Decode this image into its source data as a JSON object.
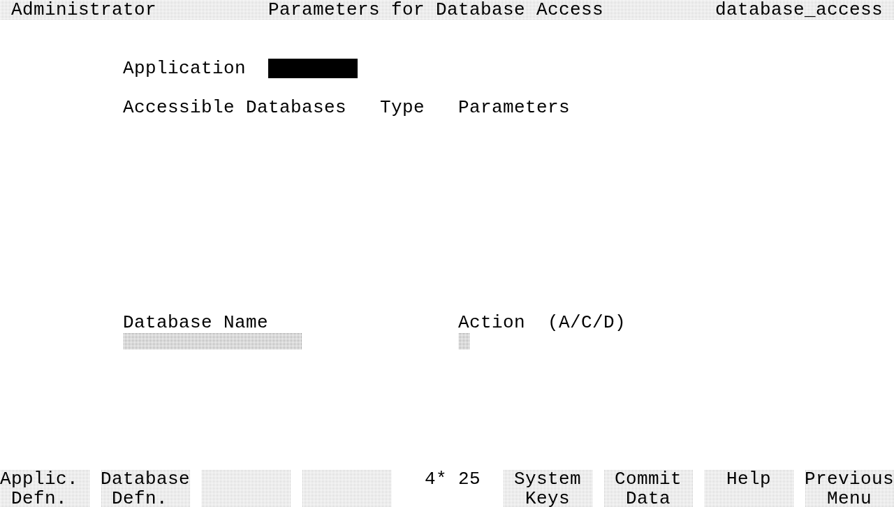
{
  "header": {
    "role": "Administrator",
    "title": "Parameters for Database Access",
    "screen_name": "database_access"
  },
  "application": {
    "label": "Application",
    "active": true
  },
  "accessible_databases": {
    "columns": [
      "Accessible Databases",
      "Type",
      "Parameters"
    ]
  },
  "database_name": {
    "label": "Database Name",
    "active": false
  },
  "action": {
    "label": "Action",
    "hint": "(A/C/D)",
    "active": false
  },
  "soft_keys": [
    {
      "kind": "key",
      "lines": [
        "Applic.",
        "Defn."
      ]
    },
    {
      "kind": "key",
      "lines": [
        "Database",
        "Defn."
      ]
    },
    {
      "kind": "blank"
    },
    {
      "kind": "blank"
    },
    {
      "kind": "key",
      "lines": [
        "System",
        "Keys"
      ]
    },
    {
      "kind": "key",
      "lines": [
        "Commit",
        "Data"
      ]
    },
    {
      "kind": "key",
      "lines": [
        "Help"
      ]
    },
    {
      "kind": "key",
      "lines": [
        "Previous",
        "Menu"
      ]
    }
  ],
  "position_indicator": "4* 25"
}
